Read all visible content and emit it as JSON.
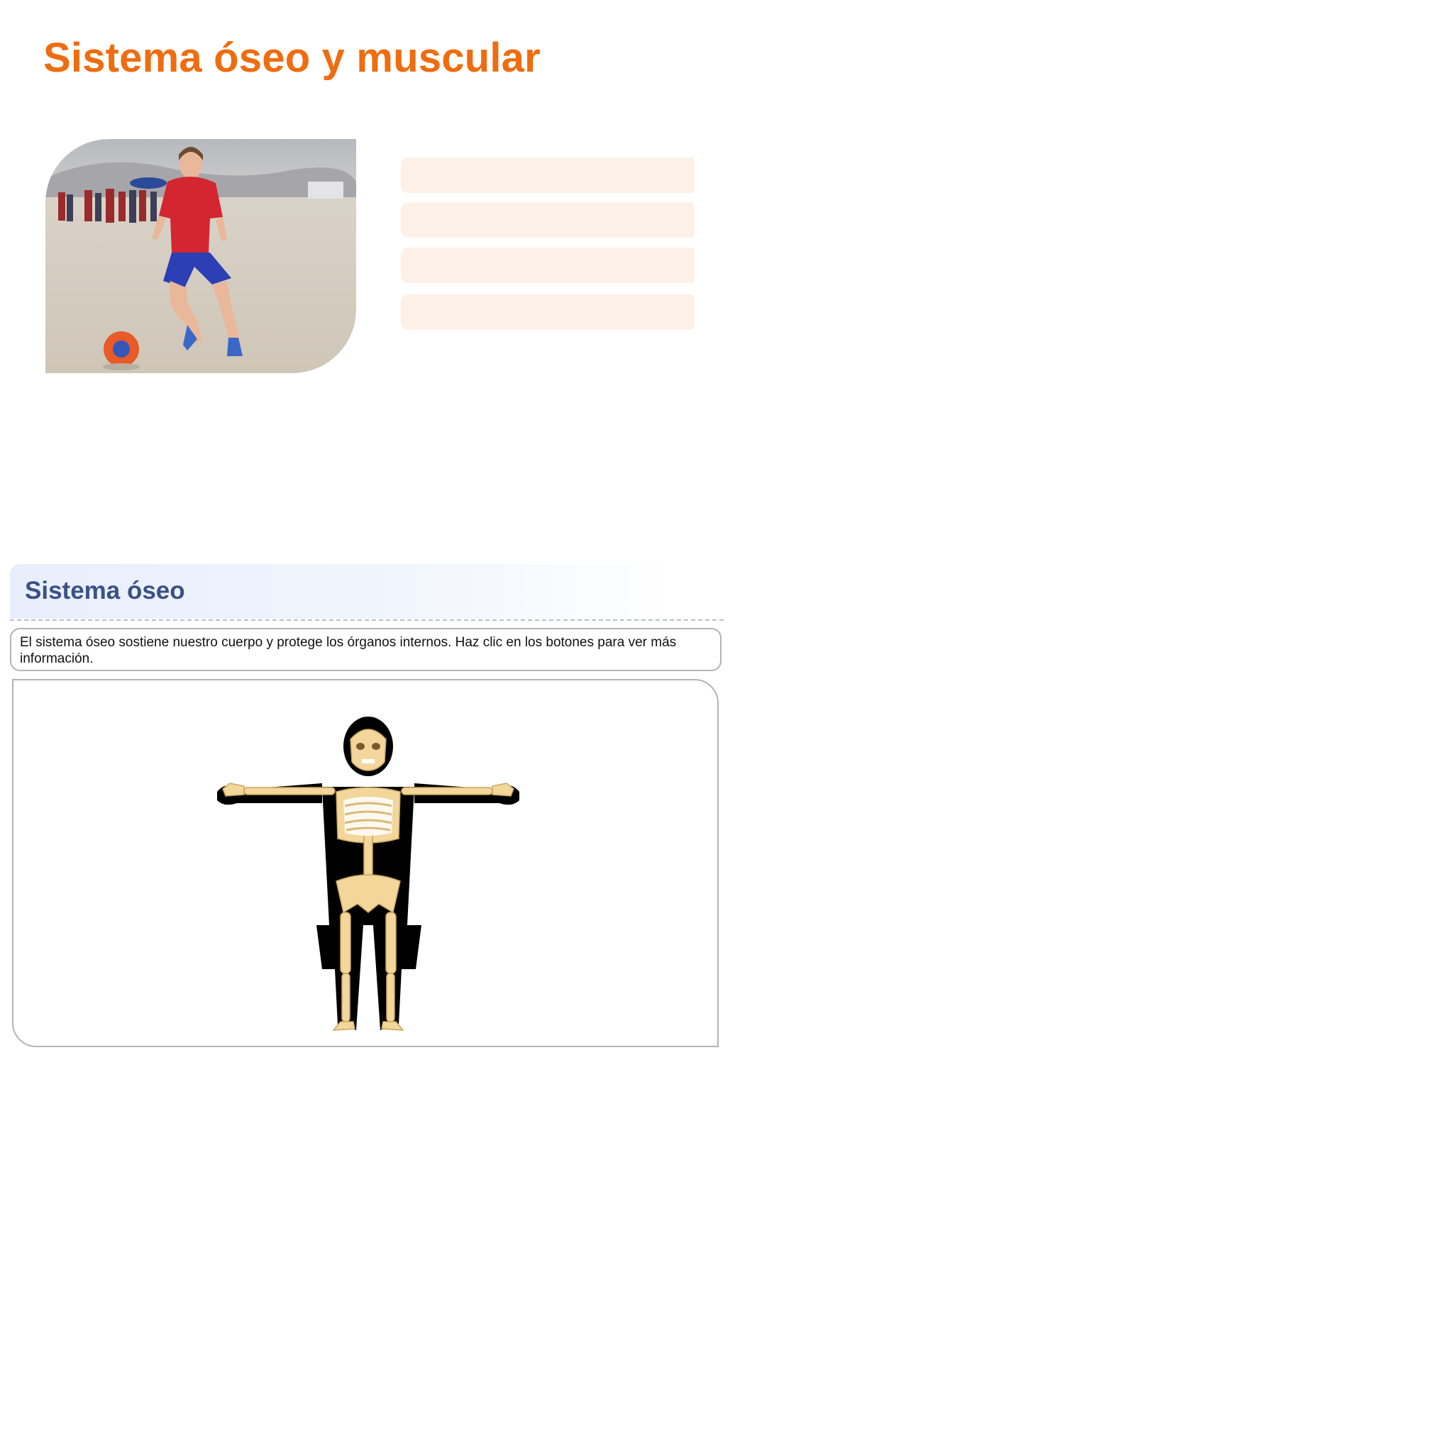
{
  "page": {
    "title": "Sistema óseo y muscular"
  },
  "hero": {
    "photo_icon": "soccer-player-photo",
    "bars": [
      "",
      "",
      "",
      ""
    ],
    "bar_color": "#fdf1e7"
  },
  "section": {
    "title": "Sistema óseo",
    "instructions": "El sistema óseo sostiene nuestro cuerpo y protege los órganos internos. Haz clic en los botones para ver más información.",
    "figure_icon": "skeleton-illustration"
  },
  "colors": {
    "title": "#ef6c0f",
    "section_title": "#3a5284",
    "section_header_bg": "#e8eefb",
    "border": "#b4b4b4",
    "bone": "#f3d69a",
    "silhouette": "#000000"
  }
}
